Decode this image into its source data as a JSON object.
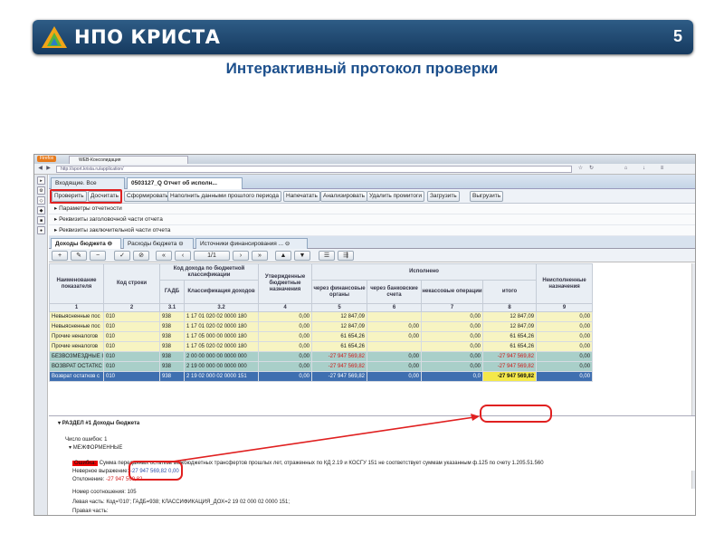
{
  "slide": {
    "brand": "НПО КРИСТА",
    "number": "5",
    "title": "Интерактивный протокол проверки"
  },
  "browser": {
    "menu_label": "Firefox",
    "tab_title": "WEB-Консолидация",
    "url": "http://sport.krista.ru/application/"
  },
  "panel_tabs": [
    "Входящие. Все",
    "0503127_Q Отчет об исполн..."
  ],
  "toolbar": [
    "Проверить",
    "Досчитать",
    "Сформировать",
    "Наполнить данными прошлого периода",
    "Напечатать",
    "Анализировать",
    "Удалить промитоги",
    "Загрузить",
    "Выгрузить"
  ],
  "sections": [
    "Параметры отчетности",
    "Реквизиты заголовочной части отчета",
    "Реквизиты заключительной части отчета"
  ],
  "data_tabs": [
    "Доходы бюджета",
    "Расходы бюджета",
    "Источники финансирования ..."
  ],
  "pager": "1/1",
  "headers": {
    "name": "Наименование показателя",
    "code": "Код строки",
    "kd": "Код дохода по бюджетной классификации",
    "gadb": "ГАДБ",
    "klass": "Классификация доходов",
    "approved": "Утвержденные бюджетные назначения",
    "executed": "Исполнено",
    "fin": "через финансовые органы",
    "bank": "через банковские счета",
    "noncash": "некассовые операции",
    "total": "итого",
    "unexec": "Неисполненные назначения",
    "nums": [
      "1",
      "2",
      "3.1",
      "3.2",
      "4",
      "5",
      "6",
      "7",
      "8",
      "9"
    ]
  },
  "rows": [
    {
      "name": "Невыясненные пос",
      "code": "010",
      "gadb": "938",
      "klass": "1 17 01 020 02 0000 180",
      "approved": "0,00",
      "fin": "12 847,09",
      "bank": "",
      "noncash": "0,00",
      "total": "12 847,09",
      "unexec": "0,00",
      "style": "yel"
    },
    {
      "name": "Невыясненные пос",
      "code": "010",
      "gadb": "938",
      "klass": "1 17 01 020 02 0000 180",
      "approved": "0,00",
      "fin": "12 847,09",
      "bank": "0,00",
      "noncash": "0,00",
      "total": "12 847,09",
      "unexec": "0,00",
      "style": "yel"
    },
    {
      "name": "Прочие неналогов",
      "code": "010",
      "gadb": "938",
      "klass": "1 17 05 000 00 0000 180",
      "approved": "0,00",
      "fin": "61 654,26",
      "bank": "0,00",
      "noncash": "0,00",
      "total": "61 654,26",
      "unexec": "0,00",
      "style": "yel"
    },
    {
      "name": "Прочие неналогов",
      "code": "010",
      "gadb": "938",
      "klass": "1 17 05 020 02 0000 180",
      "approved": "0,00",
      "fin": "61 654,26",
      "bank": "",
      "noncash": "0,00",
      "total": "61 654,26",
      "unexec": "0,00",
      "style": "yel"
    },
    {
      "name": "БЕЗВОЗМЕЗДНЫЕ I",
      "code": "010",
      "gadb": "938",
      "klass": "2 00 00 000 00 0000 000",
      "approved": "0,00",
      "fin": "-27 947 569,82",
      "bank": "0,00",
      "noncash": "0,00",
      "total": "-27 947 569,82",
      "unexec": "0,00",
      "style": "teal"
    },
    {
      "name": "ВОЗВРАТ ОСТАТКС",
      "code": "010",
      "gadb": "938",
      "klass": "2 19 00 000 00 0000 000",
      "approved": "0,00",
      "fin": "-27 947 569,82",
      "bank": "0,00",
      "noncash": "0,00",
      "total": "-27 947 569,82",
      "unexec": "0,00",
      "style": "teal"
    },
    {
      "name": "Возврат остатков с",
      "code": "010",
      "gadb": "938",
      "klass": "2 19 02 000 02 0000 151",
      "approved": "0,00",
      "fin": "-27 947 569,82",
      "bank": "0,00",
      "noncash": "0,0",
      "total": "-27 947 569,82",
      "unexec": "0,00",
      "style": "sel"
    }
  ],
  "protocol": {
    "section": "РАЗДЕЛ #1 Доходы бюджета",
    "errors": "Число ошибок: 1",
    "group": "МЕЖФОРМЕННЫЕ",
    "err_label": "Ошибка:",
    "err_text": "Сумма переданных остатков межбюджетных трансфертов прошлых лет, отраженных по КД 2.19 и КОСГУ 151 не соответствует суммам указанным ф.125 по счету 1.205.51.560",
    "k1": "Неверное выражение:",
    "v1": "-27 947 569,82",
    "v1b": "0,00",
    "k2": "Отклонение:",
    "v2": "-27 947 569,82",
    "k3": "Номер соотношения:",
    "v3": "105",
    "k4": "Левая часть:",
    "v4": "Код='010'; ГАДБ=938; КЛАССИФИКАЦИЯ_ДОХ=2 19 02 000 02 0000 151;",
    "k5": "Правая часть:"
  },
  "colors": {
    "banner": "#1f4a73",
    "title": "#1c4f8c",
    "highlight": "#e02020",
    "selected": "#3f6fb0",
    "total_cell": "#f4e84a"
  }
}
